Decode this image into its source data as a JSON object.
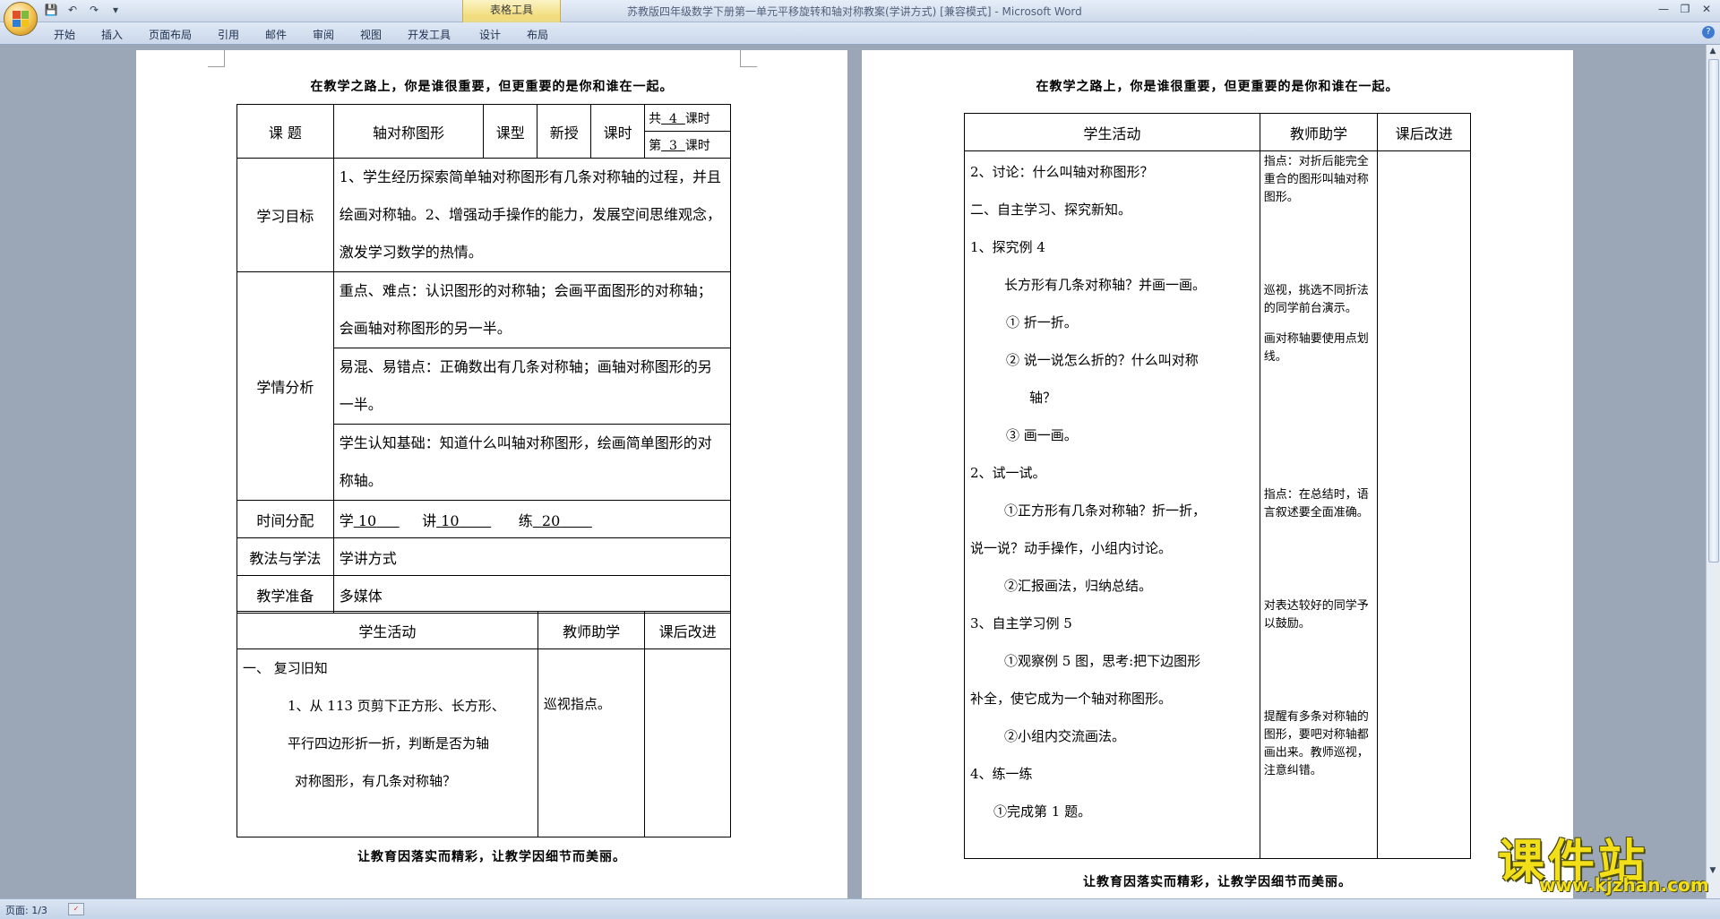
{
  "window": {
    "title": "苏教版四年级数学下册第一单元平移旋转和轴对称教案(学讲方式) [兼容模式] - Microsoft Word",
    "contextual_group": "表格工具",
    "quick_access": [
      "save-icon",
      "undo-icon",
      "redo-icon",
      "customize-icon"
    ],
    "controls": [
      "minimize",
      "restore",
      "close"
    ]
  },
  "ribbon": {
    "tabs": [
      "开始",
      "插入",
      "页面布局",
      "引用",
      "邮件",
      "审阅",
      "视图",
      "开发工具",
      "设计",
      "布局"
    ],
    "help": "?"
  },
  "page1": {
    "header": "在教学之路上，你是谁很重要，但更重要的是你和谁在一起。",
    "footer": "让教育因落实而精彩，让教学因细节而美丽。",
    "course_label": "课  题",
    "course_title": "轴对称图形",
    "type_label": "课型",
    "type_value": "新授",
    "hours_label": "课时",
    "total_prefix": "共",
    "total_num": "4",
    "hours_suffix": "课时",
    "index_prefix": "第",
    "index_num": "3",
    "goals_label": "学习目标",
    "goals_text": "1、学生经历探索简单轴对称图形有几条对称轴的过程，并且绘画对称轴。2、增强动手操作的能力，发展空间思维观念，激发学习数学的热情。",
    "analysis_label": "学情分析",
    "key_points": "重点、难点：认识图形的对称轴；会画平面图形的对称轴；会画轴对称图形的另一半。",
    "confusion": "易混、易错点：正确数出有几条对称轴；画轴对称图形的另一半。",
    "basis": "学生认知基础：知道什么叫轴对称图形，绘画简单图形的对称轴。",
    "time_label": "时间分配",
    "time_study": "学",
    "time_study_val": "10",
    "time_teach": "讲",
    "time_teach_val": "10",
    "time_practice": "练",
    "time_practice_val": "20",
    "method_label": "教法与学法",
    "method_value": "学讲方式",
    "prep_label": "教学准备",
    "prep_value": "多媒体",
    "col_student": "学生活动",
    "col_teacher": "教师助学",
    "col_after": "课后改进",
    "act_lines": [
      "一、  复习旧知",
      "1、从 113 页剪下正方形、长方形、",
      "平行四边形折一折，判断是否为轴",
      "对称图形，有几条对称轴？",
      ""
    ],
    "teacher_note": "巡视指点。"
  },
  "page2": {
    "header": "在教学之路上，你是谁很重要，但更重要的是你和谁在一起。",
    "footer": "让教育因落实而精彩，让教学因细节而美丽。",
    "col_student": "学生活动",
    "col_teacher": "教师助学",
    "col_after": "课后改进",
    "act_lines": [
      "2、讨论：什么叫轴对称图形？",
      "二、自主学习、探究新知。",
      "1、探究例 4",
      "长方形有几条对称轴？并画一画。",
      "① 折一折。",
      "② 说一说怎么折的？什么叫对称",
      "轴？",
      "③ 画一画。",
      "2、试一试。",
      "①正方形有几条对称轴？折一折，",
      "说一说？动手操作，小组内讨论。",
      "②汇报画法，归纳总结。",
      "3、自主学习例 5",
      "①观察例 5 图，思考:把下边图形",
      "补全，使它成为一个轴对称图形。",
      "②小组内交流画法。",
      "4、练一练",
      "①完成第 1 题。",
      ""
    ],
    "help_notes": {
      "n1": "指点：对折后能完全重合的图形叫轴对称图形。",
      "n2": "巡视，挑选不同折法的同学前台演示。",
      "n3": "画对称轴要使用点划线。",
      "n4": "指点：在总结时，语言叙述要全面准确。",
      "n5": "对表达较好的同学予以鼓励。",
      "n6": "提醒有多条对称轴的图形，要吧对称轴都画出来。教师巡视，注意纠错。"
    }
  },
  "status": {
    "page": "页面: 1/3"
  },
  "watermark": {
    "big": "课件站",
    "small": "www.kjzhan.com"
  },
  "colors": {
    "workspace": "#9ba7b6",
    "ribbon": "#cbd8ea",
    "watermark": "#f3df18"
  }
}
